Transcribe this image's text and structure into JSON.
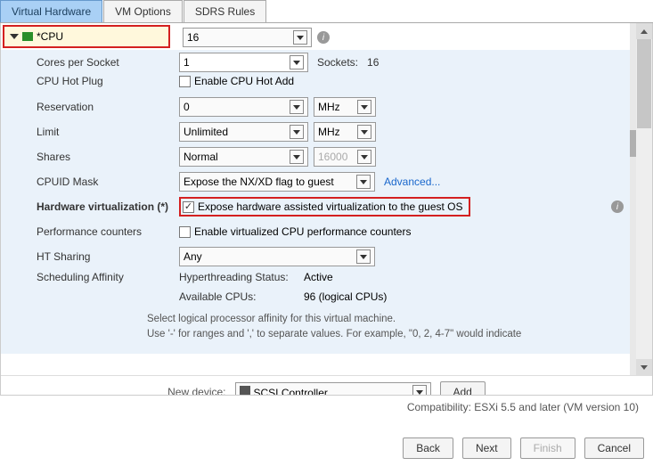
{
  "tabs": {
    "hardware": "Virtual Hardware",
    "vmoptions": "VM Options",
    "sdrs": "SDRS Rules"
  },
  "cpu": {
    "section_label": "*CPU",
    "count": "16",
    "cores_per_socket_label": "Cores per Socket",
    "cores_per_socket": "1",
    "sockets_label": "Sockets:",
    "sockets_value": "16",
    "hotplug_label": "CPU Hot Plug",
    "hotplug_checkbox": "Enable CPU Hot Add",
    "reservation_label": "Reservation",
    "reservation_value": "0",
    "reservation_unit": "MHz",
    "limit_label": "Limit",
    "limit_value": "Unlimited",
    "limit_unit": "MHz",
    "shares_label": "Shares",
    "shares_value": "Normal",
    "shares_number": "16000",
    "cpuid_label": "CPUID Mask",
    "cpuid_value": "Expose the NX/XD flag to guest",
    "cpuid_advanced": "Advanced...",
    "hwvirt_label": "Hardware virtualization (*)",
    "hwvirt_checkbox": "Expose hardware assisted virtualization to the guest OS",
    "perfcounters_label": "Performance counters",
    "perfcounters_checkbox": "Enable virtualized CPU performance counters",
    "htsharing_label": "HT Sharing",
    "htsharing_value": "Any",
    "sched_label": "Scheduling Affinity",
    "ht_status_label": "Hyperthreading Status:",
    "ht_status_value": "Active",
    "avail_cpus_label": "Available CPUs:",
    "avail_cpus_value": "96 (logical CPUs)",
    "affinity_text1": "Select logical processor affinity for this virtual machine.",
    "affinity_text2": "Use '-' for ranges and ',' to separate values. For example,  \"0, 2, 4-7\" would indicate"
  },
  "new_device": {
    "label": "New device:",
    "selected": "SCSI Controller",
    "add_btn": "Add"
  },
  "compat": "Compatibility: ESXi 5.5 and later (VM version 10)",
  "footer": {
    "back": "Back",
    "next": "Next",
    "finish": "Finish",
    "cancel": "Cancel"
  }
}
